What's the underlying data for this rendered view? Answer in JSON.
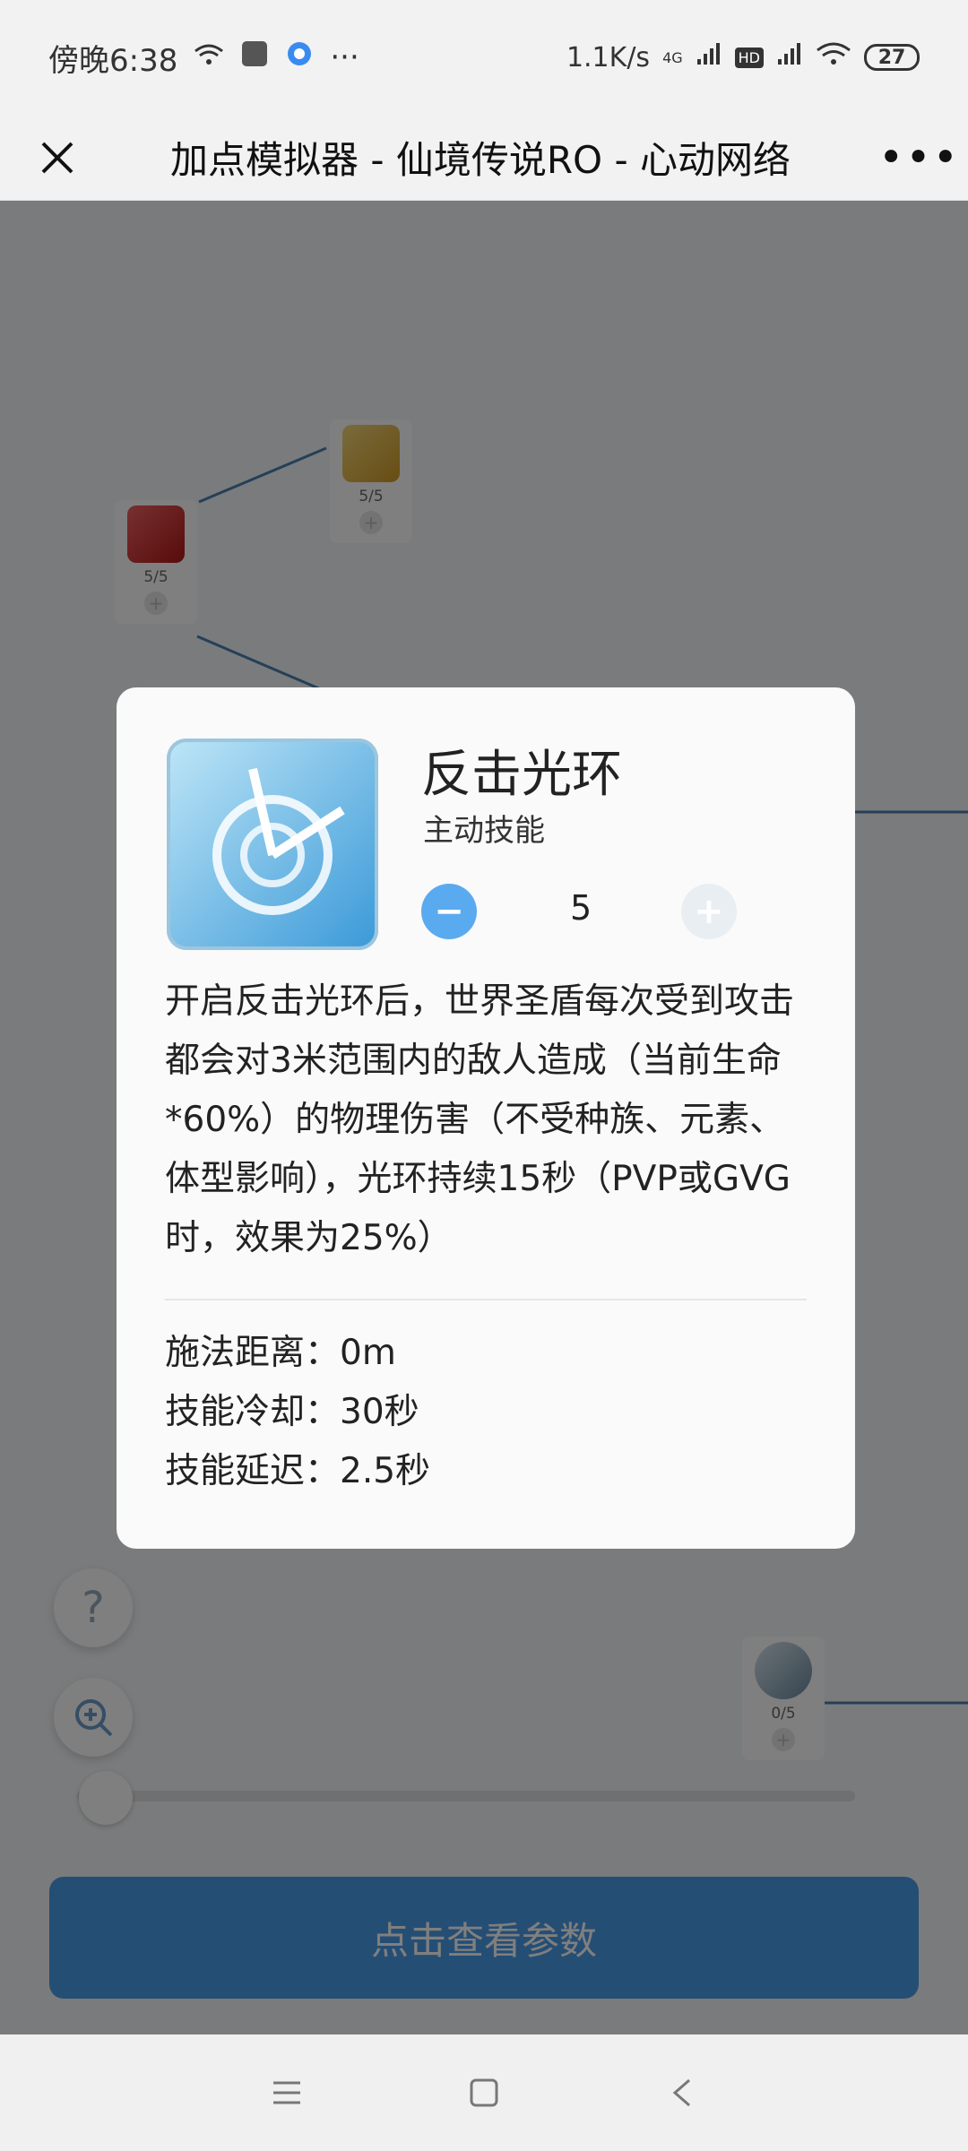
{
  "status_bar": {
    "time": "傍晚6:38",
    "speed": "1.1K/s",
    "network_4g": "4G",
    "hd": "HD",
    "battery": "27",
    "dots": "···"
  },
  "header": {
    "title": "加点模拟器 - 仙境传说RO - 心动网络"
  },
  "tree": {
    "nodes": [
      {
        "count_text": "5/5"
      },
      {
        "count_text": "5/5"
      },
      {
        "count_text": "0/5"
      }
    ],
    "params_button": "点击查看参数"
  },
  "modal": {
    "skill_name": "反击光环",
    "skill_type": "主动技能",
    "level": "5",
    "description": "开启反击光环后，世界圣盾每次受到攻击都会对3米范围内的敌人造成（当前生命*60%）的物理伤害（不受种族、元素、体型影响），光环持续15秒（PVP或GVG时，效果为25%）",
    "attributes": [
      "施法距离：0m",
      "技能冷却：30秒",
      "技能延迟：2.5秒"
    ]
  },
  "colors": {
    "accent": "#4a9ce8",
    "minus": "#5aaaf0"
  }
}
